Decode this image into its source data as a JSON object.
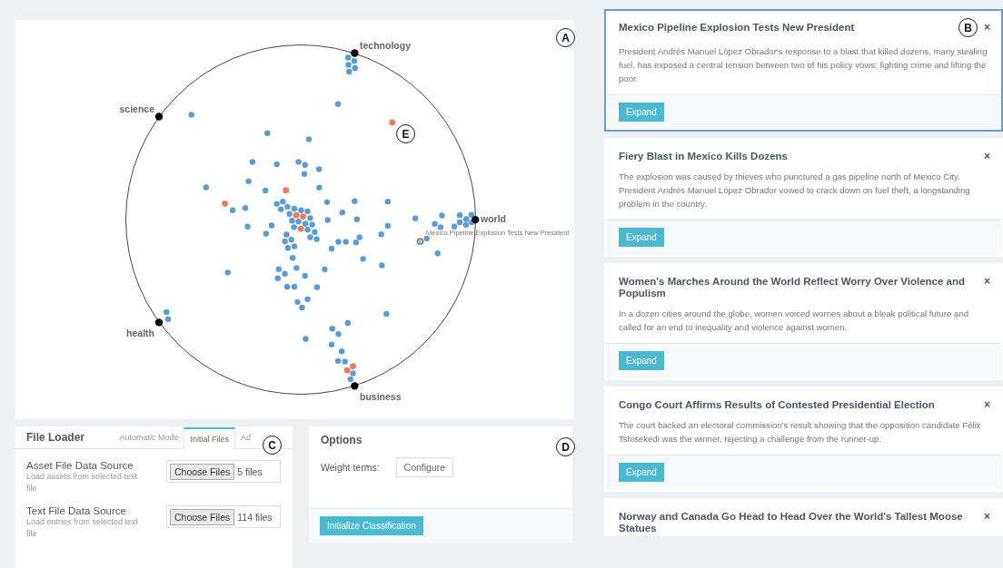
{
  "map": {
    "marker": "A",
    "inner_marker": "E",
    "anchors": [
      {
        "label": "technology"
      },
      {
        "label": "science"
      },
      {
        "label": "world"
      },
      {
        "label": "health"
      },
      {
        "label": "business"
      }
    ],
    "tooltip": "Mexico Pipeline Explosion Tests New President"
  },
  "file_loader": {
    "title": "File Loader",
    "marker": "C",
    "tabs": [
      {
        "label": "Automatic Mode",
        "selected": false
      },
      {
        "label": "Initial Files",
        "selected": true
      },
      {
        "label": "Ad",
        "selected": false
      }
    ],
    "sources": [
      {
        "title": "Asset File Data Source",
        "description": "Load assets from selected text file",
        "button": "Choose Files",
        "status": "5 files"
      },
      {
        "title": "Text File Data Source",
        "description": "Load entries from selected text file",
        "button": "Choose Files",
        "status": "114 files"
      }
    ]
  },
  "options": {
    "title": "Options",
    "marker": "D",
    "weight_label": "Weight terms:",
    "configure_button": "Configure",
    "init_button": "Initialize Classification"
  },
  "articles": [
    {
      "title": "Mexico Pipeline Explosion Tests New President",
      "marker": "B",
      "selected": true,
      "summary": "President Andrés Manuel López Obrador's response to a blast that killed dozens, many stealing fuel, has exposed a central tension between two of his policy vows: fighting crime and lifting the poor.",
      "close": "×",
      "button": "Expand"
    },
    {
      "title": "Fiery Blast in Mexico Kills Dozens",
      "selected": false,
      "summary": "The explosion was caused by thieves who punctured a gas pipeline north of Mexico City. President Andrés Manuel López Obrador vowed to crack down on fuel theft, a longstanding problem in the country.",
      "close": "×",
      "button": "Expand"
    },
    {
      "title": "Women's Marches Around the World Reflect Worry Over Violence and Populism",
      "selected": false,
      "summary": "In a dozen cities around the globe, women voiced worries about a bleak political future and called for an end to inequality and violence against women.",
      "close": "×",
      "button": "Expand"
    },
    {
      "title": "Congo Court Affirms Results of Contested Presidential Election",
      "selected": false,
      "summary": "The court backed an electoral commission's result showing that the opposition candidate Félix Tshisekedi was the winner, rejecting a challenge from the runner-up.",
      "close": "×",
      "button": "Expand"
    },
    {
      "title": "Norway and Canada Go Head to Head Over the World's Tallest Moose Statues",
      "selected": false,
      "close": "×"
    }
  ]
}
